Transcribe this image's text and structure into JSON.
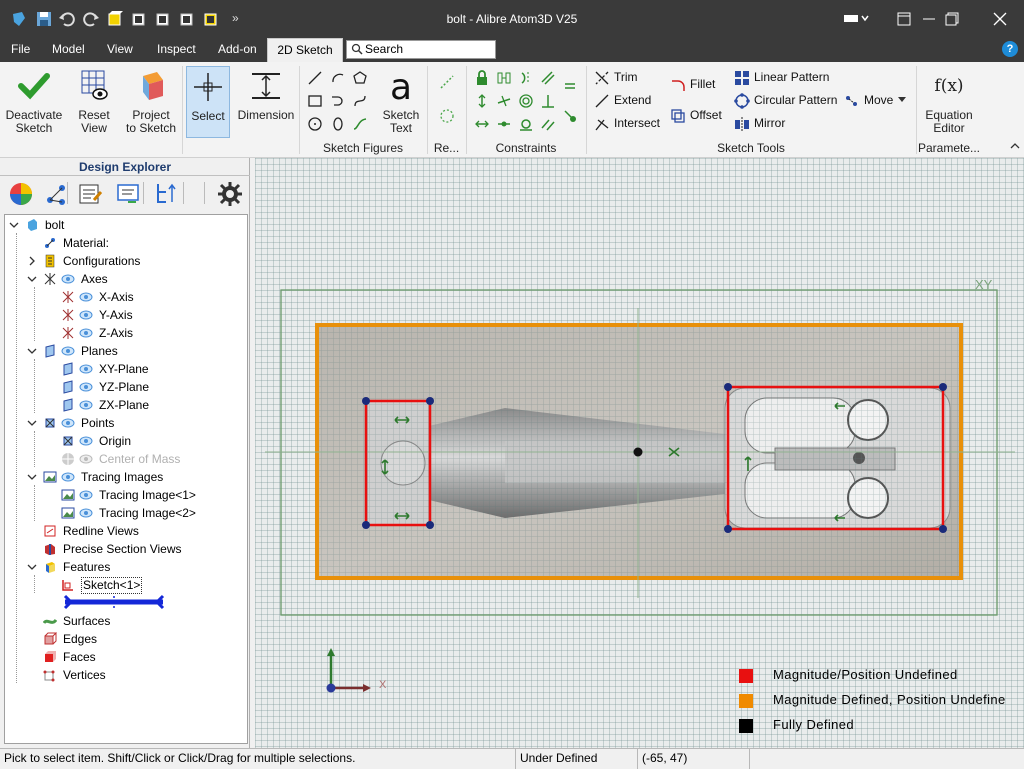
{
  "window": {
    "title": "bolt - Alibre Atom3D V25"
  },
  "menu": {
    "items": [
      "File",
      "Model",
      "View",
      "Inspect",
      "Add-on",
      "2D Sketch"
    ],
    "active": "2D Sketch",
    "search_placeholder": "Search",
    "help": "?"
  },
  "ribbon": {
    "deactivate": "Deactivate\nSketch",
    "reset_view": "Reset\nView",
    "project": "Project\nto Sketch",
    "select": "Select",
    "dimension": "Dimension",
    "sketch_text": "Sketch\nText",
    "groups": {
      "sketch_figures": "Sketch Figures",
      "re": "Re...",
      "constraints": "Constraints",
      "sketch_tools": "Sketch Tools",
      "parameters": "Paramete..."
    },
    "trim": "Trim",
    "extend": "Extend",
    "intersect": "Intersect",
    "fillet": "Fillet",
    "offset": "Offset",
    "linear_pattern": "Linear Pattern",
    "circular_pattern": "Circular Pattern",
    "mirror": "Mirror",
    "move": "Move",
    "equation_editor": "Equation\nEditor",
    "fx": "f(x)"
  },
  "explorer": {
    "title": "Design Explorer",
    "tree": {
      "root": "bolt",
      "material": "Material:",
      "configurations": "Configurations",
      "axes": "Axes",
      "x_axis": "X-Axis",
      "y_axis": "Y-Axis",
      "z_axis": "Z-Axis",
      "planes": "Planes",
      "xy_plane": "XY-Plane",
      "yz_plane": "YZ-Plane",
      "zx_plane": "ZX-Plane",
      "points": "Points",
      "origin": "Origin",
      "center_of_mass": "Center of Mass",
      "tracing_images": "Tracing Images",
      "tracing_image_1": "Tracing Image<1>",
      "tracing_image_2": "Tracing Image<2>",
      "redline_views": "Redline Views",
      "precise_section_views": "Precise Section Views",
      "features": "Features",
      "sketch_1": "Sketch<1>",
      "surfaces": "Surfaces",
      "edges": "Edges",
      "faces": "Faces",
      "vertices": "Vertices"
    }
  },
  "canvas": {
    "plane_label": "XY",
    "legend": [
      {
        "label": "Magnitude/Position Undefined",
        "color": "#e81010"
      },
      {
        "label": "Magnitude Defined, Position Undefine",
        "color": "#f08a00"
      },
      {
        "label": "Fully Defined",
        "color": "#000000"
      }
    ],
    "triad_x": "X"
  },
  "status": {
    "hint": "Pick to select item. Shift/Click or Click/Drag for multiple selections.",
    "state": "Under Defined",
    "coords": "(-65, 47)"
  },
  "colors": {
    "accent": "#1e8cd8",
    "sketch_orange": "#e8900a",
    "sketch_red": "#e81010"
  }
}
